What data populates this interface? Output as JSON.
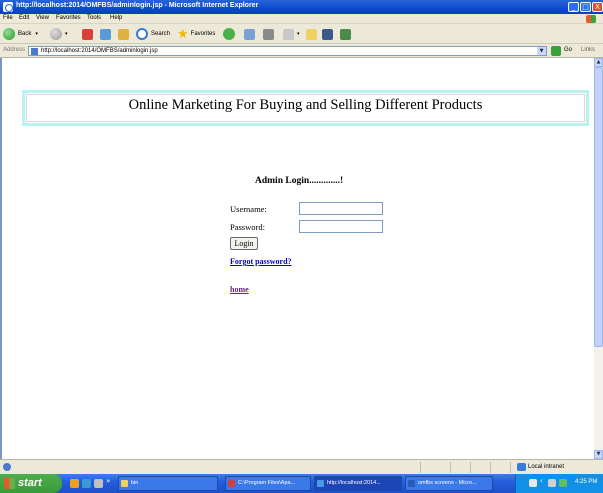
{
  "window": {
    "title": "http://localhost:2014/OMFBS/adminlogin.jsp - Microsoft Internet Explorer",
    "buttons": {
      "minimize": "_",
      "maximize": "□",
      "close": "X"
    }
  },
  "menu": [
    "File",
    "Edit",
    "View",
    "Favorites",
    "Tools",
    "Help"
  ],
  "toolbar": {
    "back": "Back",
    "search": "Search",
    "favorites": "Favorites"
  },
  "address": {
    "label": "Address",
    "url": "http://localhost:2014/OMFBS/adminlogin.jsp",
    "go": "Go",
    "links": "Links"
  },
  "page": {
    "banner_title": "Online Marketing For Buying and Selling Different Products",
    "login_heading": "Admin Login.............!",
    "username_label": "Username:",
    "password_label": "Password:",
    "username_value": "",
    "password_value": "",
    "login_button": "Login",
    "forgot_link": "Forgot password?",
    "home_link": "home"
  },
  "status": {
    "zone": "Local intranet"
  },
  "taskbar": {
    "start": "start",
    "tasks": [
      {
        "label": "bin",
        "active": false
      },
      {
        "label": "C:\\Program Files\\Apa...",
        "active": false
      },
      {
        "label": "http://localhost:2014...",
        "active": true
      },
      {
        "label": "omfbs screens - Micro...",
        "active": false
      }
    ],
    "clock": "4:25 PM"
  },
  "colors": {
    "titlebar": "#0a4ad0",
    "banner_border": "#b9f3f1",
    "link": "#0000c8",
    "visited_link": "#6b1f8e",
    "taskbar": "#245edb",
    "start": "#3a9a3a"
  }
}
